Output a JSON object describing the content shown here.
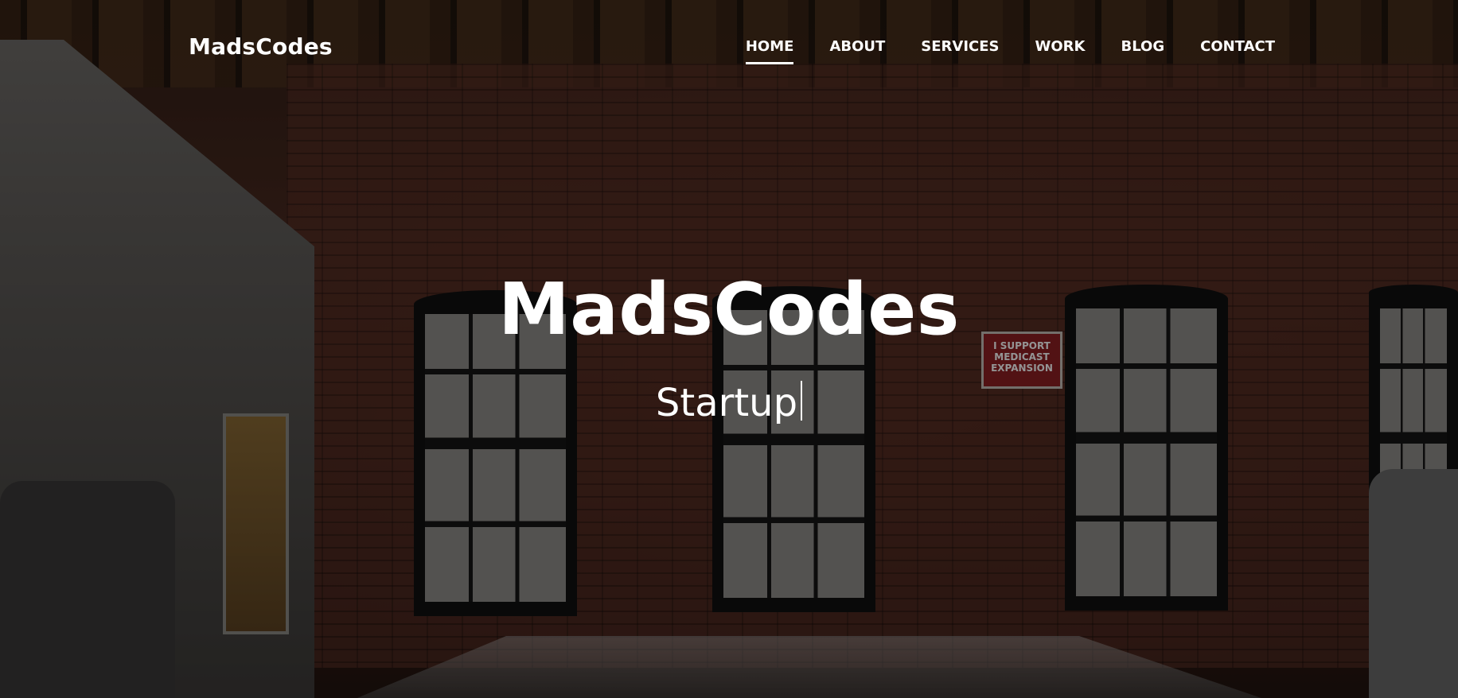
{
  "navbar": {
    "brand": "MadsCodes",
    "items": [
      {
        "label": "HOME",
        "active": true
      },
      {
        "label": "ABOUT",
        "active": false
      },
      {
        "label": "SERVICES",
        "active": false
      },
      {
        "label": "WORK",
        "active": false
      },
      {
        "label": "BLOG",
        "active": false
      },
      {
        "label": "CONTACT",
        "active": false
      }
    ]
  },
  "hero": {
    "title": "MadsCodes",
    "subtitle": "Startup",
    "background": {
      "image": "brick-wall-office-room",
      "overlay_color": "#000000"
    }
  },
  "sign": {
    "lines": [
      "I SUPPORT",
      "MEDICAST",
      "EXPANSION"
    ]
  },
  "colors": {
    "text": "#ffffff",
    "overlay": "#000000"
  }
}
